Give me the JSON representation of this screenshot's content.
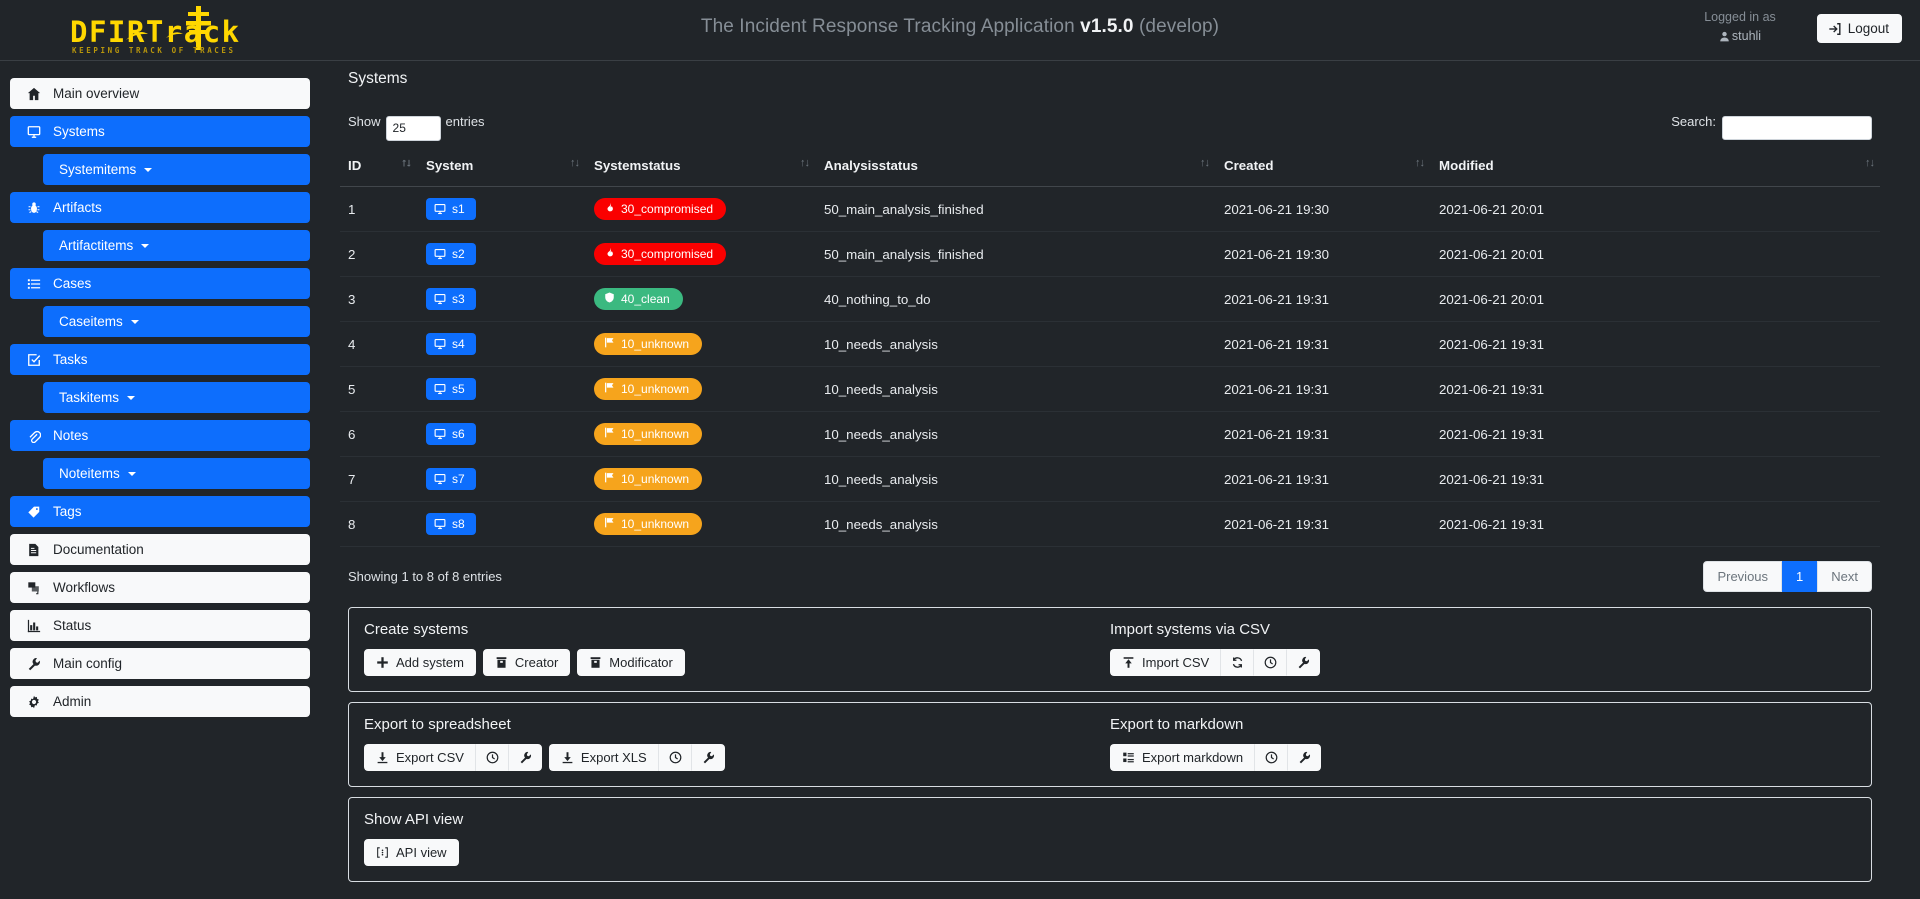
{
  "header": {
    "logo_text": "DFIRTrack",
    "logo_subtitle": "KEEPING TRACK OF TRACES",
    "title_prefix": "The Incident Response Tracking Application",
    "version": "v1.5.0",
    "branch": "(develop)",
    "logged_in_label": "Logged in as",
    "username": "stuhli",
    "logout_label": "Logout"
  },
  "sidebar": {
    "items": [
      {
        "label": "Main overview",
        "icon": "home-icon",
        "style": "light",
        "type": "item"
      },
      {
        "label": "Systems",
        "icon": "monitor-icon",
        "style": "blue",
        "type": "item"
      },
      {
        "label": "Systemitems",
        "icon": "",
        "style": "blue",
        "type": "sub"
      },
      {
        "label": "Artifacts",
        "icon": "bug-icon",
        "style": "blue",
        "type": "item"
      },
      {
        "label": "Artifactitems",
        "icon": "",
        "style": "blue",
        "type": "sub"
      },
      {
        "label": "Cases",
        "icon": "list-icon",
        "style": "blue",
        "type": "item"
      },
      {
        "label": "Caseitems",
        "icon": "",
        "style": "blue",
        "type": "sub"
      },
      {
        "label": "Tasks",
        "icon": "check-box-icon",
        "style": "blue",
        "type": "item"
      },
      {
        "label": "Taskitems",
        "icon": "",
        "style": "blue",
        "type": "sub"
      },
      {
        "label": "Notes",
        "icon": "paperclip-icon",
        "style": "blue",
        "type": "item"
      },
      {
        "label": "Noteitems",
        "icon": "",
        "style": "blue",
        "type": "sub"
      },
      {
        "label": "Tags",
        "icon": "tag-icon",
        "style": "blue",
        "type": "item"
      },
      {
        "label": "Documentation",
        "icon": "document-icon",
        "style": "light",
        "type": "item"
      },
      {
        "label": "Workflows",
        "icon": "layers-icon",
        "style": "light",
        "type": "item"
      },
      {
        "label": "Status",
        "icon": "chart-icon",
        "style": "light",
        "type": "item"
      },
      {
        "label": "Main config",
        "icon": "wrench-icon",
        "style": "light",
        "type": "item"
      },
      {
        "label": "Admin",
        "icon": "gear-icon",
        "style": "light",
        "type": "item"
      }
    ]
  },
  "main": {
    "page_title": "Systems",
    "show_label": "Show",
    "entries_label": "entries",
    "page_length": "25",
    "search_label": "Search:",
    "search_value": "",
    "search_placeholder": "",
    "columns": [
      "ID",
      "System",
      "Systemstatus",
      "Analysisstatus",
      "Created",
      "Modified"
    ],
    "rows": [
      {
        "id": "1",
        "system": "s1",
        "systemstatus": "30_compromised",
        "systemstatus_color": "red",
        "systemstatus_icon": "fire-icon",
        "analysisstatus": "50_main_analysis_finished",
        "created": "2021-06-21 19:30",
        "modified": "2021-06-21 20:01"
      },
      {
        "id": "2",
        "system": "s2",
        "systemstatus": "30_compromised",
        "systemstatus_color": "red",
        "systemstatus_icon": "fire-icon",
        "analysisstatus": "50_main_analysis_finished",
        "created": "2021-06-21 19:30",
        "modified": "2021-06-21 20:01"
      },
      {
        "id": "3",
        "system": "s3",
        "systemstatus": "40_clean",
        "systemstatus_color": "green",
        "systemstatus_icon": "shield-icon",
        "analysisstatus": "40_nothing_to_do",
        "created": "2021-06-21 19:31",
        "modified": "2021-06-21 20:01"
      },
      {
        "id": "4",
        "system": "s4",
        "systemstatus": "10_unknown",
        "systemstatus_color": "orange",
        "systemstatus_icon": "flag-icon",
        "analysisstatus": "10_needs_analysis",
        "created": "2021-06-21 19:31",
        "modified": "2021-06-21 19:31"
      },
      {
        "id": "5",
        "system": "s5",
        "systemstatus": "10_unknown",
        "systemstatus_color": "orange",
        "systemstatus_icon": "flag-icon",
        "analysisstatus": "10_needs_analysis",
        "created": "2021-06-21 19:31",
        "modified": "2021-06-21 19:31"
      },
      {
        "id": "6",
        "system": "s6",
        "systemstatus": "10_unknown",
        "systemstatus_color": "orange",
        "systemstatus_icon": "flag-icon",
        "analysisstatus": "10_needs_analysis",
        "created": "2021-06-21 19:31",
        "modified": "2021-06-21 19:31"
      },
      {
        "id": "7",
        "system": "s7",
        "systemstatus": "10_unknown",
        "systemstatus_color": "orange",
        "systemstatus_icon": "flag-icon",
        "analysisstatus": "10_needs_analysis",
        "created": "2021-06-21 19:31",
        "modified": "2021-06-21 19:31"
      },
      {
        "id": "8",
        "system": "s8",
        "systemstatus": "10_unknown",
        "systemstatus_color": "orange",
        "systemstatus_icon": "flag-icon",
        "analysisstatus": "10_needs_analysis",
        "created": "2021-06-21 19:31",
        "modified": "2021-06-21 19:31"
      }
    ],
    "showing_text": "Showing 1 to 8 of 8 entries",
    "pagination": {
      "previous": "Previous",
      "page": "1",
      "next": "Next"
    }
  },
  "cards": {
    "create": {
      "title": "Create systems",
      "add_label": "Add system",
      "creator_label": "Creator",
      "modificator_label": "Modificator"
    },
    "import": {
      "title": "Import systems via CSV",
      "import_label": "Import CSV"
    },
    "export_spreadsheet": {
      "title": "Export to spreadsheet",
      "csv_label": "Export CSV",
      "xls_label": "Export XLS"
    },
    "export_markdown": {
      "title": "Export to markdown",
      "markdown_label": "Export markdown"
    },
    "api": {
      "title": "Show API view",
      "api_label": "API view"
    }
  },
  "colors": {
    "accent_blue": "#0d6efd",
    "brand_yellow": "#ffd700",
    "status_red": "#fa0000",
    "status_green": "#3bb980",
    "status_orange": "#f6a41c",
    "background": "#212529"
  }
}
